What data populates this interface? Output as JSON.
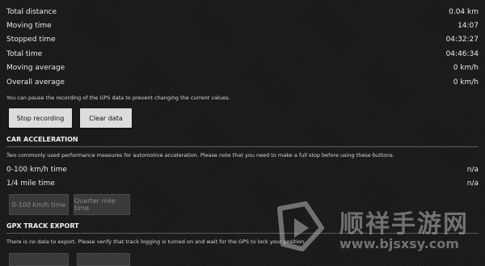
{
  "stats": [
    {
      "label": "Total distance",
      "value": "0.04 km"
    },
    {
      "label": "Moving time",
      "value": "14:07"
    },
    {
      "label": "Stopped time",
      "value": "04:32:27"
    },
    {
      "label": "Total time",
      "value": "04:46:34"
    },
    {
      "label": "Moving average",
      "value": "0 km/h"
    },
    {
      "label": "Overall average",
      "value": "0 km/h"
    }
  ],
  "recording": {
    "note": "You can pause the recording of the GPS data to prevent changing the current values.",
    "stop_label": "Stop recording",
    "clear_label": "Clear data"
  },
  "acceleration": {
    "title": "CAR ACCELERATION",
    "note": "Two commonly used performance measures for automotive acceleration. Please note that you need to make a full stop before using these buttons.",
    "rows": [
      {
        "label": "0-100 km/h time",
        "value": "n/a"
      },
      {
        "label": "1/4 mile time",
        "value": "n/a"
      }
    ],
    "btn_0_100": "0-100 km/h time",
    "btn_quarter": "Quarter mile time"
  },
  "gpx": {
    "title": "GPX TRACK EXPORT",
    "note": "There is no data to export. Please verify that track logging is turned on and wait for the GPS to lock your position."
  },
  "watermark": {
    "cn": "顺祥手游网",
    "url": "www.bjsxsy.com",
    "logo_icon": "play-logo-icon"
  }
}
